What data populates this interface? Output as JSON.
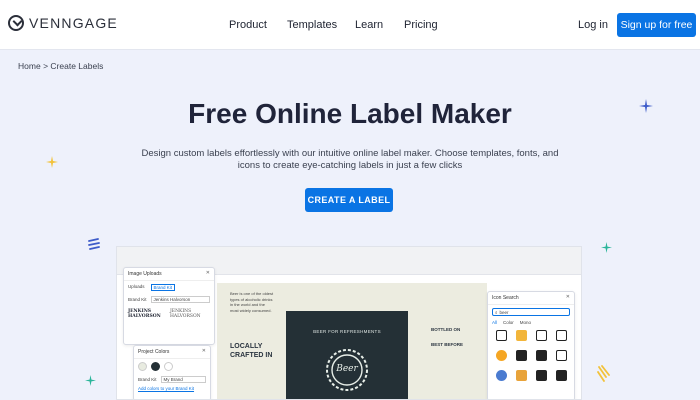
{
  "nav": {
    "brand": "VENNGAGE",
    "links": [
      "Product",
      "Templates",
      "Learn",
      "Pricing"
    ],
    "login": "Log in",
    "signup": "Sign up for free"
  },
  "breadcrumb": {
    "home": "Home",
    "separator": ">",
    "current": "Create Labels"
  },
  "hero": {
    "title": "Free Online Label Maker",
    "description": "Design custom labels effortlessly with our intuitive online label maker. Choose templates, fonts, and icons to create eye-catching labels in just a few clicks",
    "cta": "CREATE A LABEL"
  },
  "mockup": {
    "uploads_panel": {
      "title": "Image Uploads",
      "tabs": [
        "Uploads",
        "Brand Kit"
      ],
      "brand_kit_label": "Brand Kit",
      "brand_kit_value": "Jenkins Halvorson",
      "logo_text_1": "JENKINS HALVORSON",
      "logo_text_2": "JENKINS HALVORSON"
    },
    "colors_panel": {
      "title": "Project Colors",
      "brand_kit_label": "Brand Kit",
      "brand_kit_value": "My Brand",
      "link": "Add colors to your Brand Kit"
    },
    "icon_panel": {
      "title": "Icon Search",
      "query": "beer",
      "filters": [
        "All",
        "Color",
        "Mono"
      ]
    },
    "label": {
      "left_text": "Beer is one of the oldest types of alcoholic drinks in the world and the most widely consumed.",
      "locally": "LOCALLY",
      "crafted": "CRAFTED IN",
      "center_top": "BEER FOR REFRESHMENTS",
      "badge": "Beer",
      "bottled_on": "BOTTLED ON",
      "best_before": "BEST BEFORE"
    }
  },
  "colors": {
    "accent": "#0a74e4",
    "background": "#eef1fb",
    "label_dark": "#243036"
  }
}
